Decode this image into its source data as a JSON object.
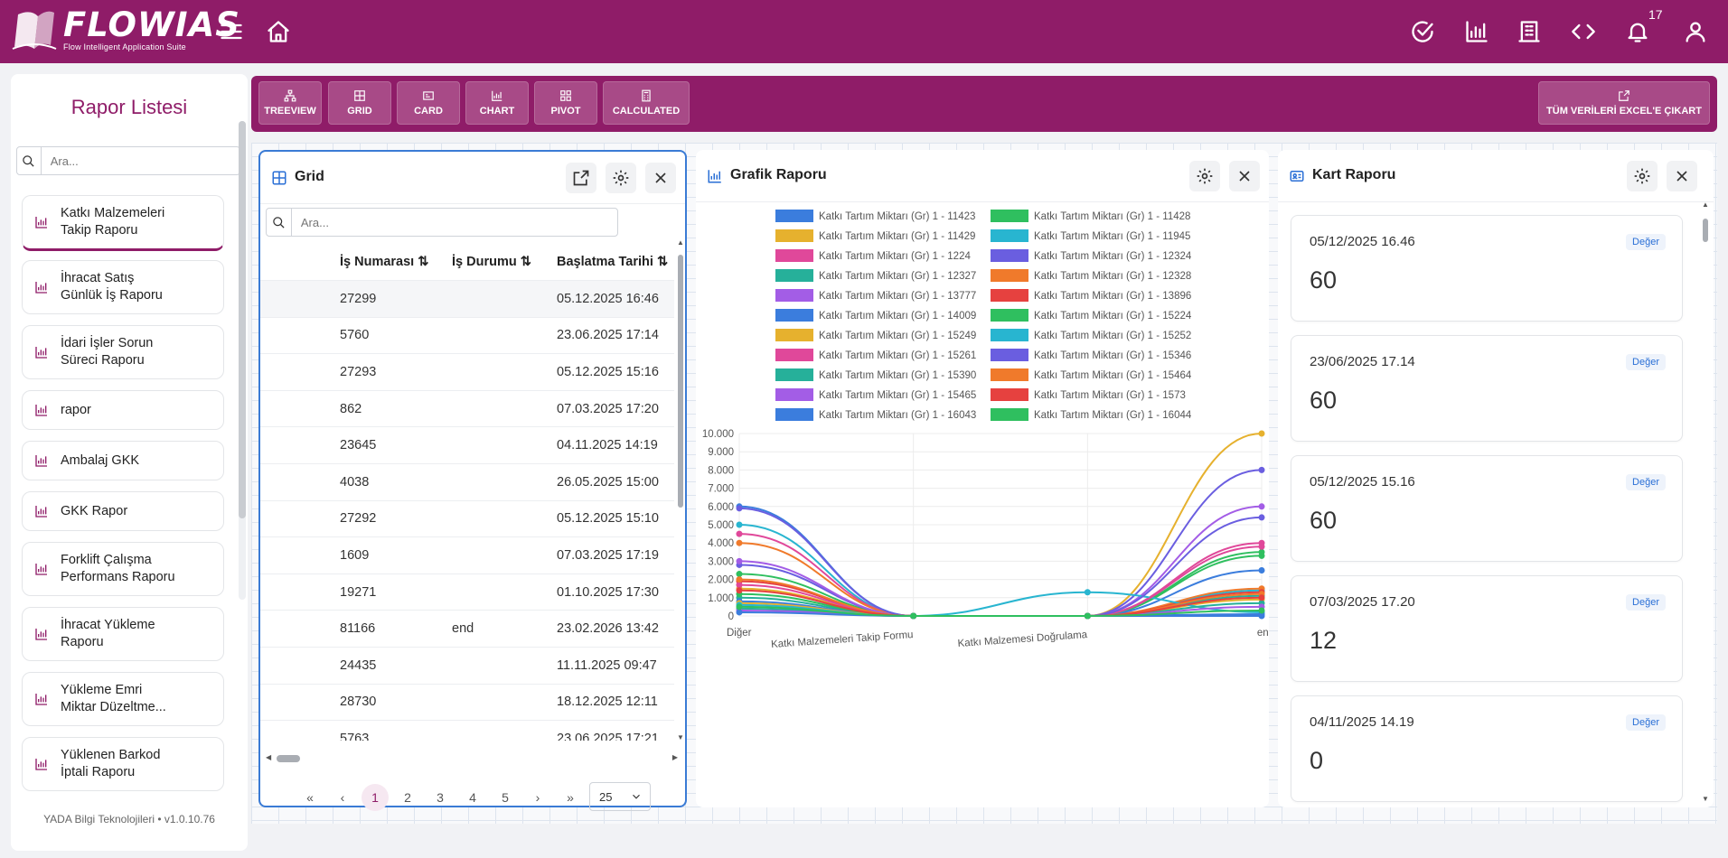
{
  "brand": {
    "name": "FLOWIAS",
    "tagline": "Flow Intelligent Application Suite"
  },
  "topbar": {
    "notification_count": "17"
  },
  "sidebar": {
    "title": "Rapor Listesi",
    "search_placeholder": "Ara...",
    "items": [
      {
        "label1": "Katkı Malzemeleri",
        "label2": "Takip Raporu"
      },
      {
        "label1": "İhracat Satış",
        "label2": "Günlük İş Raporu"
      },
      {
        "label1": "İdari İşler Sorun",
        "label2": "Süreci Raporu"
      },
      {
        "label1": "rapor",
        "label2": ""
      },
      {
        "label1": "Ambalaj GKK",
        "label2": ""
      },
      {
        "label1": "GKK Rapor",
        "label2": ""
      },
      {
        "label1": "Forklift Çalışma",
        "label2": "Performans Raporu"
      },
      {
        "label1": "İhracat Yükleme",
        "label2": "Raporu"
      },
      {
        "label1": "Yükleme Emri",
        "label2": "Miktar Düzeltme..."
      },
      {
        "label1": "Yüklenen Barkod",
        "label2": "İptali Raporu"
      }
    ],
    "footer": "YADA Bilgi Teknolojileri • v1.0.10.76"
  },
  "toolbar": {
    "buttons": [
      "TREEVIEW",
      "GRID",
      "CARD",
      "CHART",
      "PIVOT",
      "CALCULATED"
    ],
    "export_label": "TÜM VERİLERİ EXCEL'E ÇIKART"
  },
  "grid_panel": {
    "title": "Grid",
    "search_placeholder": "Ara...",
    "columns": [
      "İş Numarası",
      "İş Durumu",
      "Başlatma Tarihi"
    ],
    "rows": [
      [
        "27299",
        "",
        "05.12.2025 16:46"
      ],
      [
        "5760",
        "",
        "23.06.2025 17:14"
      ],
      [
        "27293",
        "",
        "05.12.2025 15:16"
      ],
      [
        "862",
        "",
        "07.03.2025 17:20"
      ],
      [
        "23645",
        "",
        "04.11.2025 14:19"
      ],
      [
        "4038",
        "",
        "26.05.2025 15:00"
      ],
      [
        "27292",
        "",
        "05.12.2025 15:10"
      ],
      [
        "1609",
        "",
        "07.03.2025 17:19"
      ],
      [
        "19271",
        "",
        "01.10.2025 17:30"
      ],
      [
        "81166",
        "end",
        "23.02.2026 13:42"
      ],
      [
        "24435",
        "",
        "11.11.2025 09:47"
      ],
      [
        "28730",
        "",
        "18.12.2025 12:11"
      ],
      [
        "5763",
        "",
        "23.06.2025 17:21"
      ]
    ],
    "pages": [
      "1",
      "2",
      "3",
      "4",
      "5"
    ],
    "current_page": "1",
    "page_size": "25"
  },
  "chart_panel": {
    "title": "Grafik Raporu"
  },
  "card_panel": {
    "title": "Kart Raporu",
    "cards": [
      {
        "date": "05/12/2025 16.46",
        "badge": "Değer",
        "value": "60"
      },
      {
        "date": "23/06/2025 17.14",
        "badge": "Değer",
        "value": "60"
      },
      {
        "date": "05/12/2025 15.16",
        "badge": "Değer",
        "value": "60"
      },
      {
        "date": "07/03/2025 17.20",
        "badge": "Değer",
        "value": "12"
      },
      {
        "date": "04/11/2025 14.19",
        "badge": "Değer",
        "value": "0"
      }
    ]
  },
  "chart_data": {
    "type": "line",
    "categories": [
      "Diğer",
      "Katkı Malzemeleri Takip Formu",
      "Katkı Malzemesi Doğrulama",
      "end"
    ],
    "ylim": [
      0,
      10000
    ],
    "yticks": [
      "0",
      "1.000",
      "2.000",
      "3.000",
      "4.000",
      "5.000",
      "6.000",
      "7.000",
      "8.000",
      "9.000",
      "10.000"
    ],
    "legend_position": "top",
    "series": [
      {
        "name": "Katkı Tartım Miktarı (Gr) 1 - 11423",
        "color": "#3b7ddd",
        "values": [
          6000,
          0,
          0,
          0
        ]
      },
      {
        "name": "Katkı Tartım Miktarı (Gr) 1 - 11428",
        "color": "#2fbf5f",
        "values": [
          2300,
          0,
          0,
          3300
        ]
      },
      {
        "name": "Katkı Tartım Miktarı (Gr) 1 - 11429",
        "color": "#e6b12e",
        "values": [
          1500,
          0,
          0,
          10000
        ]
      },
      {
        "name": "Katkı Tartım Miktarı (Gr) 1 - 11945",
        "color": "#28b5d0",
        "values": [
          5000,
          0,
          0,
          1400
        ]
      },
      {
        "name": "Katkı Tartım Miktarı (Gr) 1 - 1224",
        "color": "#e0489a",
        "values": [
          4500,
          0,
          0,
          4000
        ]
      },
      {
        "name": "Katkı Tartım Miktarı (Gr) 1 - 12324",
        "color": "#6a5ee0",
        "values": [
          2800,
          0,
          0,
          8000
        ]
      },
      {
        "name": "Katkı Tartım Miktarı (Gr) 1 - 12327",
        "color": "#26b09a",
        "values": [
          1000,
          0,
          0,
          1100
        ]
      },
      {
        "name": "Katkı Tartım Miktarı (Gr) 1 - 12328",
        "color": "#f07a2b",
        "values": [
          4000,
          0,
          0,
          1500
        ]
      },
      {
        "name": "Katkı Tartım Miktarı (Gr) 1 - 13777",
        "color": "#a35de6",
        "values": [
          3000,
          0,
          0,
          6000
        ]
      },
      {
        "name": "Katkı Tartım Miktarı (Gr) 1 - 13896",
        "color": "#e6413f",
        "values": [
          1900,
          0,
          0,
          1300
        ]
      },
      {
        "name": "Katkı Tartım Miktarı (Gr) 1 - 14009",
        "color": "#3b7ddd",
        "values": [
          800,
          0,
          0,
          2500
        ]
      },
      {
        "name": "Katkı Tartım Miktarı (Gr) 1 - 15224",
        "color": "#2fbf5f",
        "values": [
          1200,
          0,
          0,
          3500
        ]
      },
      {
        "name": "Katkı Tartım Miktarı (Gr) 1 - 15249",
        "color": "#e6b12e",
        "values": [
          700,
          0,
          0,
          900
        ]
      },
      {
        "name": "Katkı Tartım Miktarı (Gr) 1 - 15252",
        "color": "#28b5d0",
        "values": [
          600,
          0,
          1300,
          200
        ]
      },
      {
        "name": "Katkı Tartım Miktarı (Gr) 1 - 15261",
        "color": "#e0489a",
        "values": [
          1700,
          0,
          0,
          3800
        ]
      },
      {
        "name": "Katkı Tartım Miktarı (Gr) 1 - 15346",
        "color": "#6a5ee0",
        "values": [
          5900,
          0,
          0,
          5400
        ]
      },
      {
        "name": "Katkı Tartım Miktarı (Gr) 1 - 15390",
        "color": "#26b09a",
        "values": [
          400,
          0,
          0,
          700
        ]
      },
      {
        "name": "Katkı Tartım Miktarı (Gr) 1 - 15464",
        "color": "#f07a2b",
        "values": [
          2000,
          0,
          0,
          1200
        ]
      },
      {
        "name": "Katkı Tartım Miktarı (Gr) 1 - 15465",
        "color": "#a35de6",
        "values": [
          300,
          0,
          0,
          500
        ]
      },
      {
        "name": "Katkı Tartım Miktarı (Gr) 1 - 1573",
        "color": "#e6413f",
        "values": [
          1400,
          0,
          0,
          1000
        ]
      },
      {
        "name": "Katkı Tartım Miktarı (Gr) 1 - 16043",
        "color": "#3b7ddd",
        "values": [
          200,
          0,
          0,
          100
        ]
      },
      {
        "name": "Katkı Tartım Miktarı (Gr) 1 - 16044",
        "color": "#2fbf5f",
        "values": [
          500,
          0,
          0,
          300
        ]
      }
    ]
  }
}
